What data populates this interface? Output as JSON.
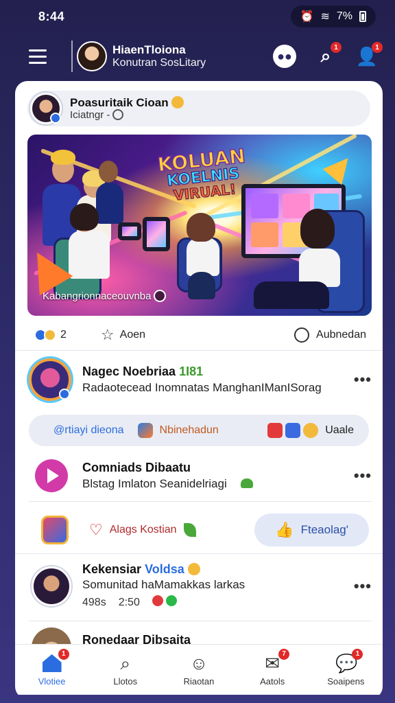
{
  "status_bar": {
    "time": "8:44",
    "battery_percent": "7%"
  },
  "header": {
    "name": "HiaenTloiona",
    "subtitle": "Konutran SosLitary",
    "notifications_badge": "1",
    "profile_badge": "1"
  },
  "composer": {
    "title": "Poasuritaik Cioan",
    "subtitle": "Iciatngr -"
  },
  "hero": {
    "title_line1": "KOLUAN",
    "title_line2": "KOELNIS",
    "title_line3": "VIRUAL!",
    "caption": "Kabangrionnaceouvnba"
  },
  "reaction_bar": {
    "count": "2",
    "star_label": "Aoen",
    "share_label": "Aubnedan"
  },
  "post1": {
    "title": "Nagec Noebriaa",
    "title_accent": "1I81",
    "subtitle": "Radaotecead Inomnatas ManghanIManISorag"
  },
  "pill_row": {
    "a": "@rtiayi dieona",
    "b": "Nbinehadun",
    "c": "Uaale"
  },
  "post2": {
    "title": "Comniads Dibaatu",
    "subtitle": "Blstag Imlaton Seanidelriagi"
  },
  "action_row": {
    "like_label": "Alags Kostian",
    "follow_label": "Fteaolag'"
  },
  "post3": {
    "title": "Kekensiar",
    "title_accent": "Voldsa",
    "subtitle": "Somunitad haMamakkas larkas",
    "meta_a": "498s",
    "meta_b": "2:50"
  },
  "post4": {
    "title": "Ronedaar Dibsaita"
  },
  "bottom_nav": [
    {
      "label": "Vlotiee",
      "badge": "1"
    },
    {
      "label": "Llotos",
      "badge": ""
    },
    {
      "label": "Riaotan",
      "badge": ""
    },
    {
      "label": "Aatols",
      "badge": "7"
    },
    {
      "label": "Soaipens",
      "badge": "1"
    }
  ],
  "colors": {
    "accent": "#2b6de0",
    "background": "#2b2a66",
    "badge": "#e02a2a"
  }
}
